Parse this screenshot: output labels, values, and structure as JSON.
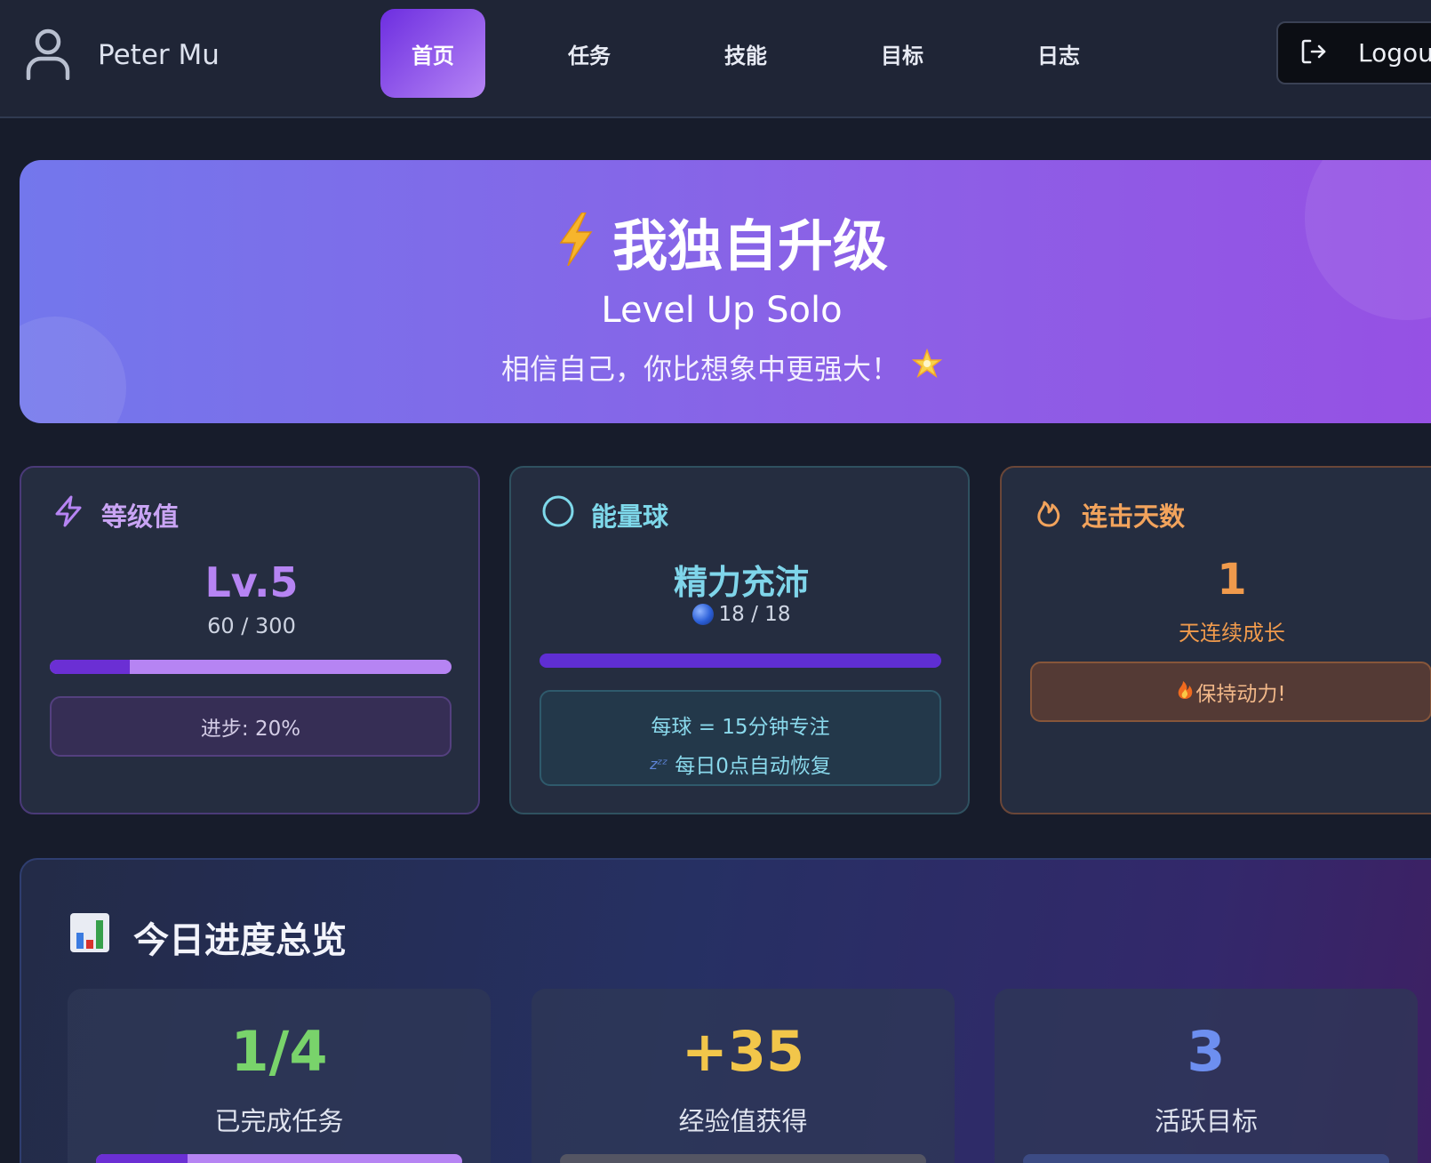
{
  "header": {
    "user_name": "Peter Mu",
    "nav": [
      "首页",
      "任务",
      "技能",
      "目标",
      "日志"
    ],
    "active_nav": "首页",
    "logout_label": "Logout"
  },
  "hero": {
    "title": "我独自升级",
    "subtitle": "Level Up Solo",
    "motto": "相信自己，你比想象中更强大！",
    "icons": [
      "lightning-icon",
      "star-icon"
    ]
  },
  "stats": {
    "level": {
      "title": "等级值",
      "value": "Lv.5",
      "xp": "60 / 300",
      "progress_fraction": 0.2,
      "progress_text": "进步: 20%"
    },
    "energy": {
      "title": "能量球",
      "status": "精力充沛",
      "count": "18 / 18",
      "fill_fraction": 1.0,
      "info_line1": "每球 = 15分钟专注",
      "info_line2": "每日0点自动恢复"
    },
    "streak": {
      "title": "连击天数",
      "value": "1",
      "subtitle": "天连续成长",
      "badge": "保持动力!"
    }
  },
  "overview": {
    "title": "今日进度总览",
    "cards": [
      {
        "value": "1/4",
        "label": "已完成任务",
        "color": "#79d36b",
        "progress_fraction": 0.25
      },
      {
        "value": "+35",
        "label": "经验值获得",
        "color": "#f2c64a"
      },
      {
        "value": "3",
        "label": "活跃目标",
        "color": "#6d8ff0"
      }
    ]
  },
  "colors": {
    "accent_purple": "#6b2fd4",
    "level_purple": "#b684f3",
    "energy_cyan": "#7fd5ea",
    "streak_orange": "#f09a4c"
  }
}
